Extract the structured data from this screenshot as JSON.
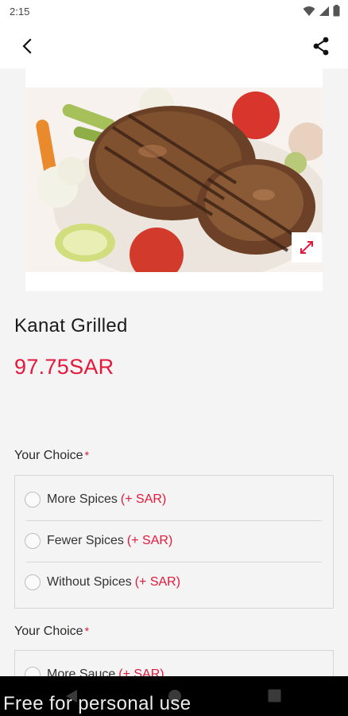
{
  "status_bar": {
    "time": "2:15",
    "icons": [
      "wifi-icon",
      "signal-icon",
      "battery-icon"
    ]
  },
  "app_bar": {
    "back_icon": "back-arrow-icon",
    "share_icon": "share-icon"
  },
  "product": {
    "image_alt": "grilled fish with vegetables",
    "expand_icon": "expand-icon",
    "name": "Kanat Grilled",
    "price": "97.75SAR"
  },
  "choice_groups": [
    {
      "label": "Your Choice",
      "required_mark": "*",
      "options": [
        {
          "label": "More Spices",
          "extra": "(+ SAR)"
        },
        {
          "label": "Fewer Spices",
          "extra": "(+ SAR)"
        },
        {
          "label": "Without Spices",
          "extra": "(+ SAR)"
        }
      ]
    },
    {
      "label": "Your Choice",
      "required_mark": "*",
      "options": [
        {
          "label": "More Sauce",
          "extra": "(+ SAR)"
        }
      ]
    }
  ],
  "nav_bar": {
    "icons": [
      "nav-back-icon",
      "nav-home-icon",
      "nav-recents-icon"
    ]
  },
  "watermark": "Free for personal use",
  "colors": {
    "accent": "#e4183b",
    "background": "#f4f4f4",
    "text": "#222222"
  }
}
